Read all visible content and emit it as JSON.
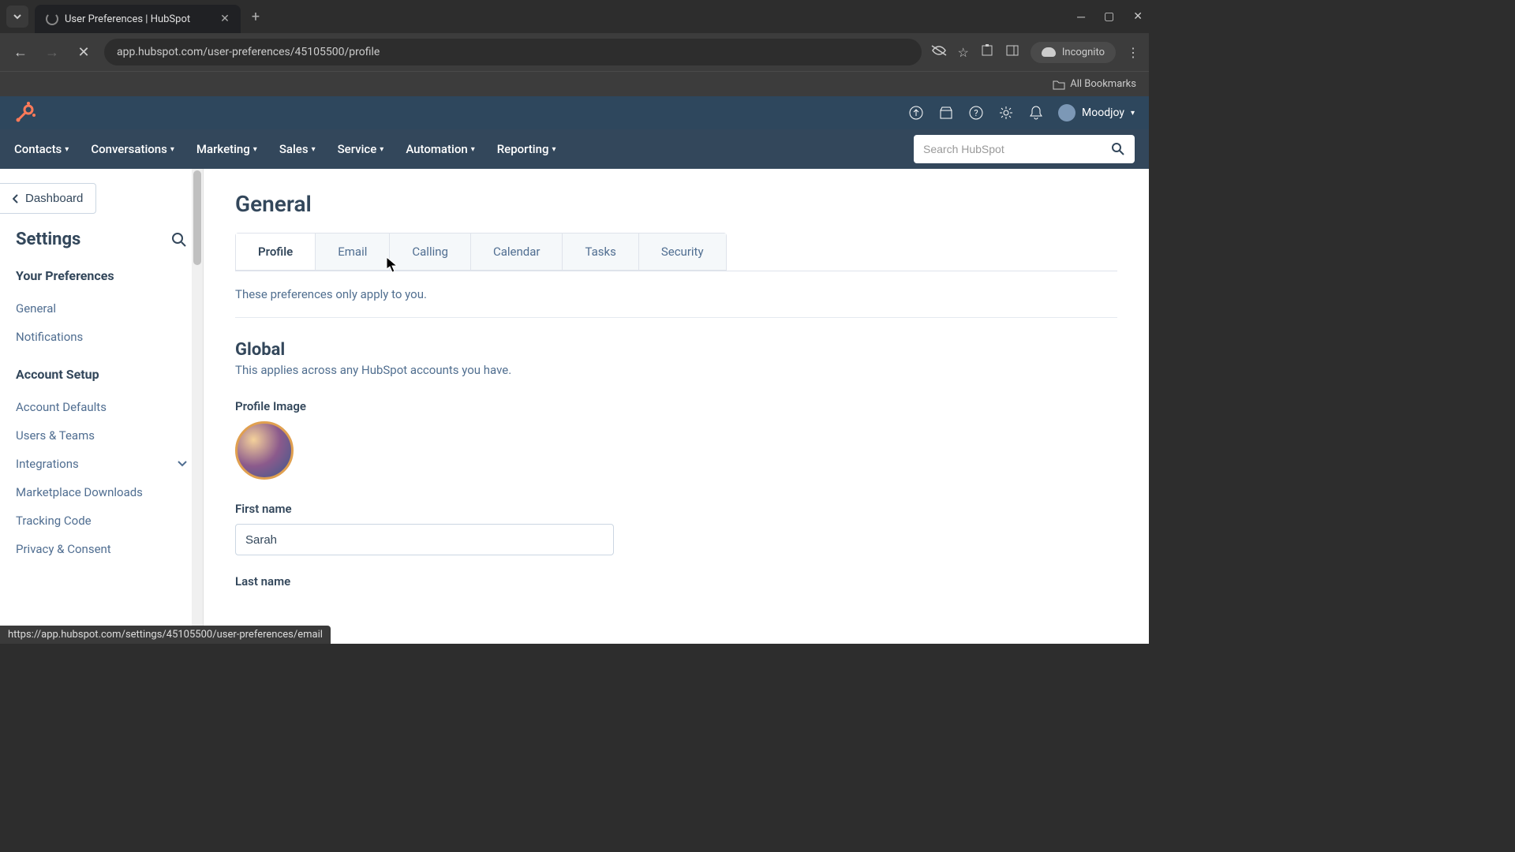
{
  "browser": {
    "tab_title": "User Preferences | HubSpot",
    "url": "app.hubspot.com/user-preferences/45105500/profile",
    "incognito_label": "Incognito",
    "bookmarks_label": "All Bookmarks",
    "status_url": "https://app.hubspot.com/settings/45105500/user-preferences/email"
  },
  "header": {
    "user_name": "Moodjoy"
  },
  "nav": {
    "items": [
      "Contacts",
      "Conversations",
      "Marketing",
      "Sales",
      "Service",
      "Automation",
      "Reporting"
    ],
    "search_placeholder": "Search HubSpot"
  },
  "sidebar": {
    "dashboard_label": "Dashboard",
    "settings_title": "Settings",
    "sections": [
      {
        "title": "Your Preferences",
        "items": [
          "General",
          "Notifications"
        ]
      },
      {
        "title": "Account Setup",
        "items": [
          "Account Defaults",
          "Users & Teams",
          "Integrations",
          "Marketplace Downloads",
          "Tracking Code",
          "Privacy & Consent"
        ]
      }
    ]
  },
  "main": {
    "page_title": "General",
    "tabs": [
      "Profile",
      "Email",
      "Calling",
      "Calendar",
      "Tasks",
      "Security"
    ],
    "help_text": "These preferences only apply to you.",
    "global_title": "Global",
    "global_sub": "This applies across any HubSpot accounts you have.",
    "profile_image_label": "Profile Image",
    "first_name_label": "First name",
    "first_name_value": "Sarah",
    "last_name_label": "Last name"
  }
}
